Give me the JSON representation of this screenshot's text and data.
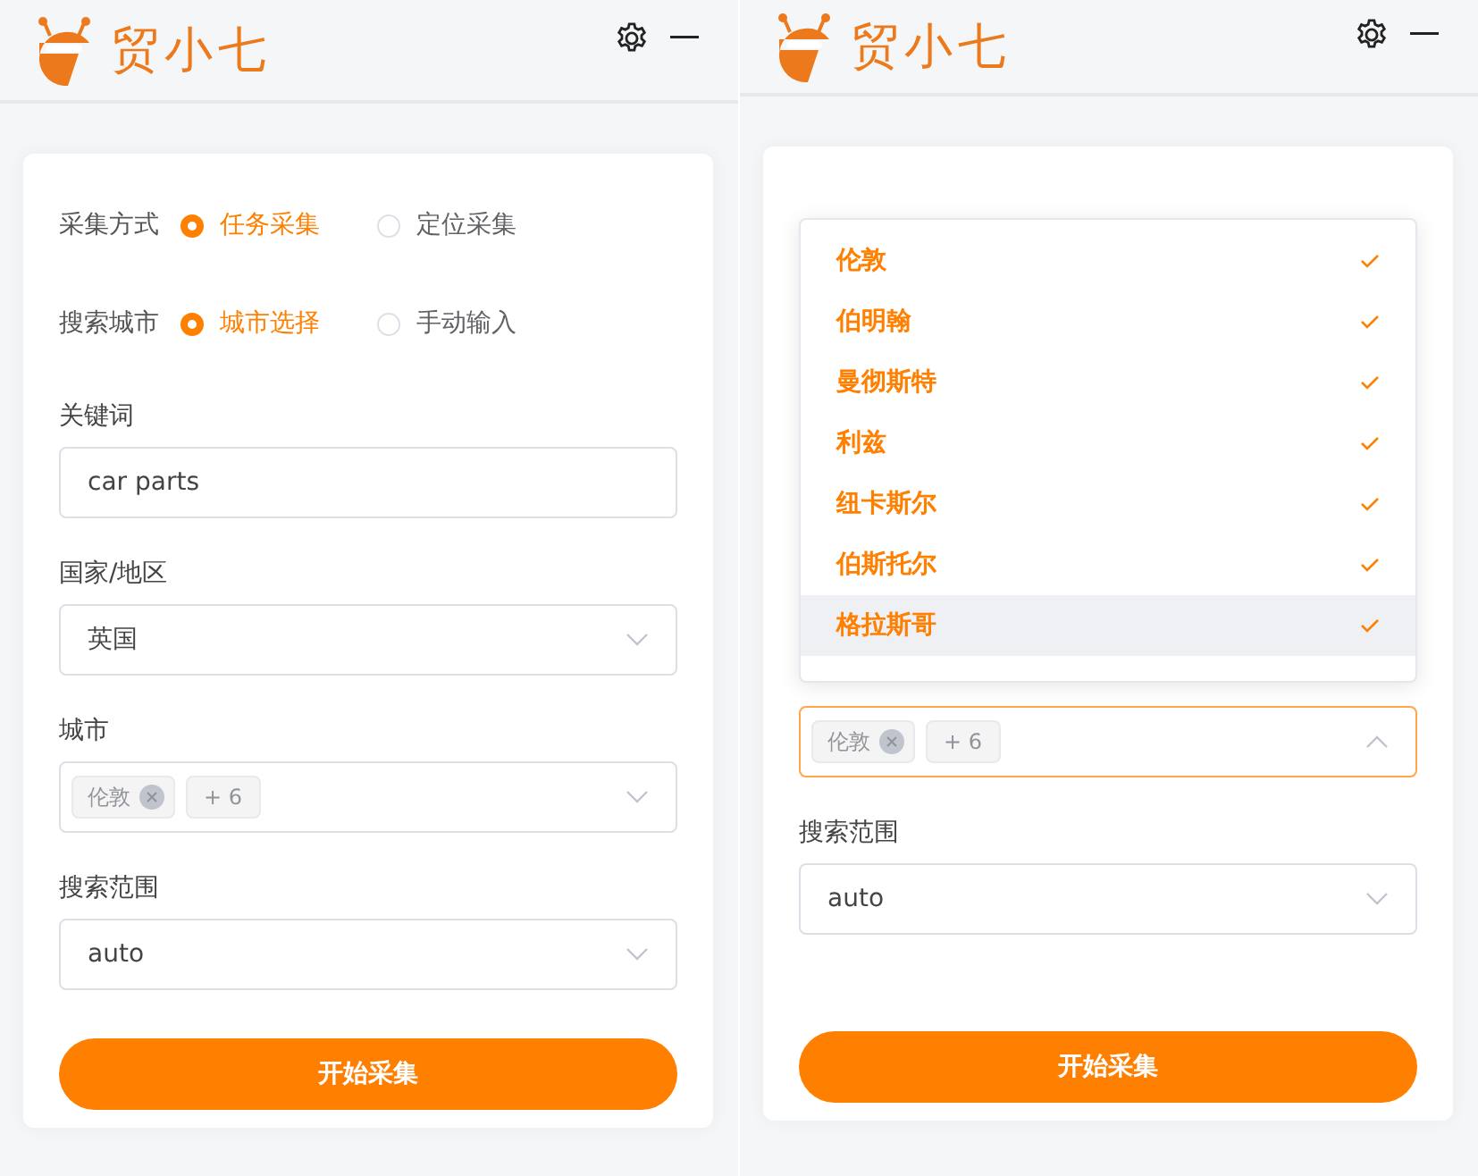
{
  "panels": [
    {
      "logo": "贸小七",
      "mode_row": {
        "label": "采集方式",
        "options": [
          {
            "label": "任务采集",
            "selected": true
          },
          {
            "label": "定位采集",
            "selected": false
          }
        ]
      },
      "city_mode_row": {
        "label": "搜索城市",
        "options": [
          {
            "label": "城市选择",
            "selected": true
          },
          {
            "label": "手动输入",
            "selected": false
          }
        ]
      },
      "keyword": {
        "label": "关键词",
        "value": "car parts"
      },
      "country": {
        "label": "国家/地区",
        "value": "英国"
      },
      "city": {
        "label": "城市",
        "tags": [
          "伦敦"
        ],
        "more": "+ 6",
        "focused": false
      },
      "range": {
        "label": "搜索范围",
        "value": "auto"
      },
      "submit": "开始采集"
    },
    {
      "logo": "贸小七",
      "city_dropdown": {
        "items": [
          {
            "label": "伦敦",
            "selected": true,
            "hovered": false
          },
          {
            "label": "伯明翰",
            "selected": true,
            "hovered": false
          },
          {
            "label": "曼彻斯特",
            "selected": true,
            "hovered": false
          },
          {
            "label": "利兹",
            "selected": true,
            "hovered": false
          },
          {
            "label": "纽卡斯尔",
            "selected": true,
            "hovered": false
          },
          {
            "label": "伯斯托尔",
            "selected": true,
            "hovered": false
          },
          {
            "label": "格拉斯哥",
            "selected": true,
            "hovered": true
          }
        ]
      },
      "city": {
        "tags": [
          "伦敦"
        ],
        "more": "+ 6",
        "focused": true
      },
      "range": {
        "label": "搜索范围",
        "value": "auto"
      },
      "submit": "开始采集"
    }
  ]
}
